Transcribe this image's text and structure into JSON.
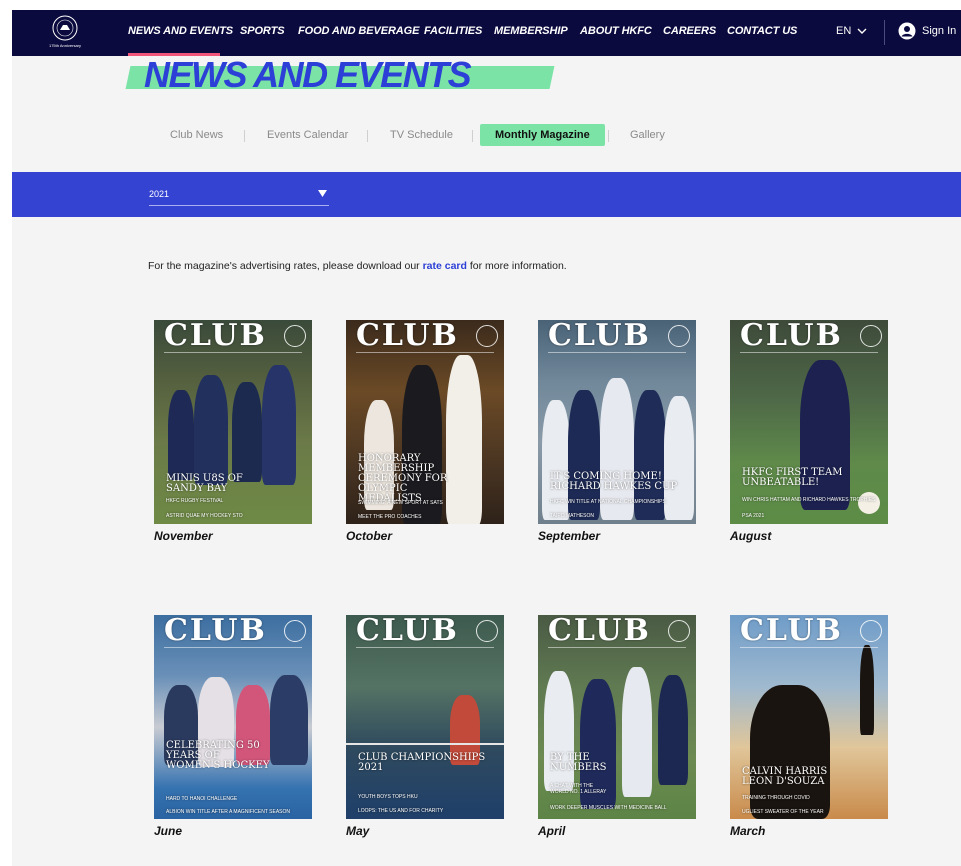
{
  "nav": {
    "logo_caption": "175th Anniversary",
    "items": [
      {
        "label": "NEWS AND EVENTS"
      },
      {
        "label": "SPORTS"
      },
      {
        "label": "FOOD AND BEVERAGE"
      },
      {
        "label": "FACILITIES"
      },
      {
        "label": "MEMBERSHIP"
      },
      {
        "label": "ABOUT HKFC"
      },
      {
        "label": "CAREERS"
      },
      {
        "label": "CONTACT US"
      }
    ],
    "language": "EN",
    "sign_in": "Sign In",
    "colors": {
      "bar": "#0b0a3e",
      "active": "#f0567a"
    }
  },
  "page": {
    "title": "NEWS AND EVENTS",
    "accent": "#2c3fd6",
    "highlight": "#7be3a6"
  },
  "subtabs": [
    {
      "label": "Club News"
    },
    {
      "label": "Events Calendar"
    },
    {
      "label": "TV Schedule"
    },
    {
      "label": "Monthly Magazine",
      "active": true
    },
    {
      "label": "Gallery"
    }
  ],
  "year_filter": {
    "selected": "2021"
  },
  "info": {
    "before": "For the magazine's advertising rates, please download our ",
    "link": "rate card",
    "after": " for more information."
  },
  "magazines": [
    {
      "month": "November",
      "masthead": "CLUB",
      "headline": "MINIS U8S OF SANDY BAY",
      "sub1": "HKFC RUGBY FESTIVAL",
      "sub2": "ASTRID QUAE MY HOCKEY STO"
    },
    {
      "month": "October",
      "masthead": "CLUB",
      "headline": "HONORARY MEMBERSHIP CEREMONY FOR OLYMPIC MEDALISTS",
      "sub1": "SWIMMING: A NEW SPORT AT SATS",
      "sub2": "MEET THE PRO COACHES"
    },
    {
      "month": "September",
      "masthead": "CLUB",
      "headline": "IT'S COMING HOME! RICHARD HAWKES CUP",
      "sub1": "HKFC WIN TITLE AT NATIONAL CHAMPIONSHIPS",
      "sub2": "TAIPO MATHESON"
    },
    {
      "month": "August",
      "masthead": "CLUB",
      "headline": "HKFC FIRST TEAM UNBEATABLE!",
      "sub1": "WIN CHRIS HATTAM AND RICHARD HAWKES TROPHIES",
      "sub2": "PSA 2021"
    },
    {
      "month": "June",
      "masthead": "CLUB",
      "headline": "CELEBRATING 50 YEARS OF WOMEN'S HOCKEY",
      "sub1": "HARD TO HANOI CHALLENGE",
      "sub2": "ALBION WIN TITLE AFTER A MAGNIFICENT SEASON"
    },
    {
      "month": "May",
      "masthead": "CLUB",
      "headline": "CLUB CHAMPIONSHIPS 2021",
      "sub1": "YOUTH BOYS TOPS HKU",
      "sub2": "LOOPS: THE US AND FOR CHARITY"
    },
    {
      "month": "April",
      "masthead": "CLUB",
      "headline": "BY THE NUMBERS",
      "sub1": "A CHAT WITH THE WORLD NO. 1 ALLERAY",
      "sub2": "WORK DEEPER MUSCLES WITH MEDICINE BALL"
    },
    {
      "month": "March",
      "masthead": "CLUB",
      "headline": "CALVIN HARRIS LEON D'SOUZA",
      "sub1": "TRAINING THROUGH COVID",
      "sub2": "UGLIEST SWEATER OF THE YEAR"
    }
  ]
}
